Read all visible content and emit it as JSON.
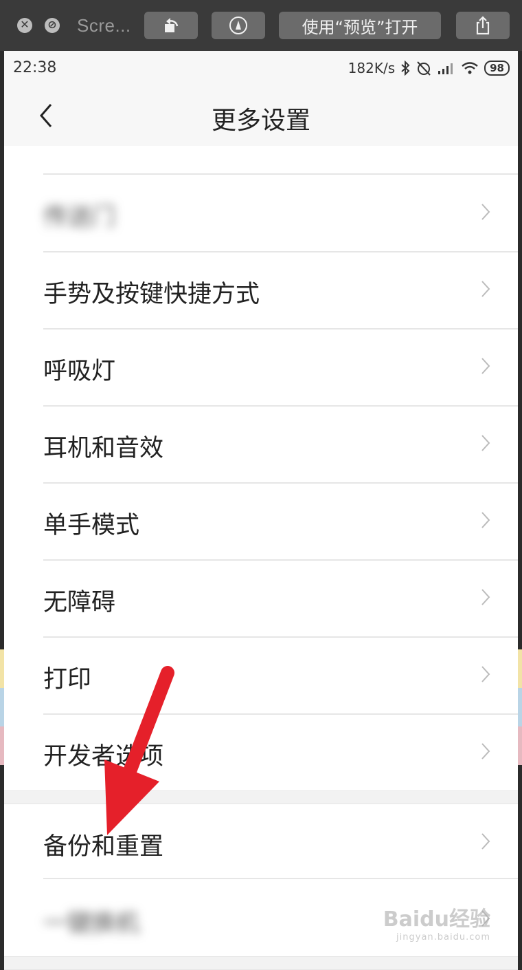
{
  "window": {
    "title": "Scre...",
    "open_with_preview_label": "使用“预览”打开"
  },
  "status_bar": {
    "time": "22:38",
    "network_speed": "182K/s",
    "battery": "98"
  },
  "nav": {
    "title": "更多设置"
  },
  "items": [
    {
      "label": "传送门",
      "blurred": true
    },
    {
      "label": "手势及按键快捷方式"
    },
    {
      "label": "呼吸灯"
    },
    {
      "label": "耳机和音效"
    },
    {
      "label": "单手模式"
    },
    {
      "label": "无障碍"
    },
    {
      "label": "打印"
    },
    {
      "label": "开发者选项"
    },
    {
      "label": "备份和重置"
    },
    {
      "label": "一键换机",
      "blurred": true
    }
  ],
  "watermark": {
    "brand": "Baidu经验",
    "url": "jingyan.baidu.com"
  },
  "colors": {
    "annotation_arrow": "#e5202a"
  }
}
